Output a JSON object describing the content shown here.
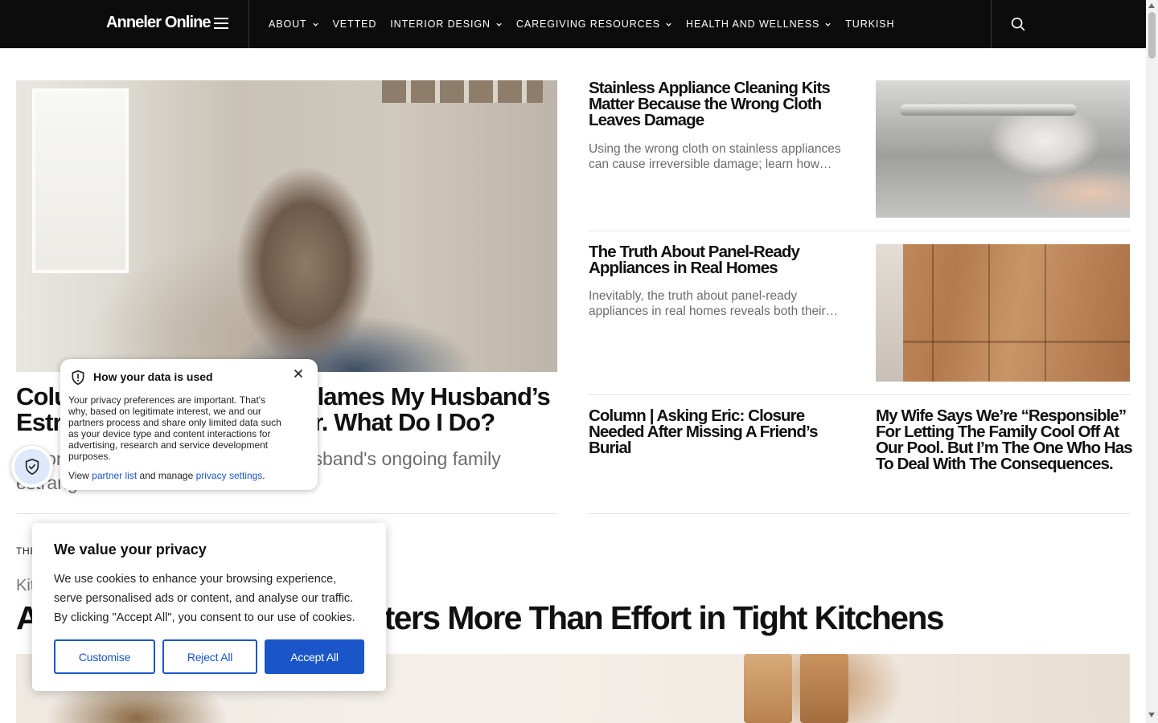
{
  "header": {
    "logo": "Anneler Online",
    "nav": [
      {
        "label": "ABOUT",
        "has_dropdown": true
      },
      {
        "label": "VETTED",
        "has_dropdown": false
      },
      {
        "label": "INTERIOR DESIGN",
        "has_dropdown": true
      },
      {
        "label": "CAREGIVING RESOURCES",
        "has_dropdown": true
      },
      {
        "label": "HEALTH AND WELLNESS",
        "has_dropdown": true
      },
      {
        "label": "TURKISH",
        "has_dropdown": false
      }
    ],
    "icons": {
      "menu": "hamburger-icon",
      "search": "search-icon"
    },
    "background": "#0c0c0c"
  },
  "lead_article": {
    "headline": "Column | My Stepmother Blames My Husband’s Estrangement on His Sister. What Do I Do?",
    "excerpt": "A woman seeks advice about her husband's ongoing family estrangement"
  },
  "articles": [
    {
      "headline": "Stainless Appliance Cleaning Kits Matter Because the Wrong Cloth Leaves Damage",
      "excerpt": "Using the wrong cloth on stainless appliances can cause irreversible damage; learn how…"
    },
    {
      "headline": "The Truth About Panel-Ready Appliances in Real Homes",
      "excerpt": "Inevitably, the truth about panel-ready appliances in real homes reveals both their…"
    },
    {
      "headline": "Column | Asking Eric: Closure Needed After Missing A Friend’s Burial"
    },
    {
      "headline": "My Wife Says We’re “Responsible” For Letting The Family Cool Off At Our Pool. But I’m The One Who Has To Deal With The Consequences."
    }
  ],
  "section": {
    "label": "THE LATEST",
    "category": "Kitchen",
    "title": "Appliance Placement Matters More Than Effort in Tight Kitchens"
  },
  "data_popup": {
    "title": "How your data is used",
    "body": "Your privacy preferences are important. That's why, based on legitimate interest, we and our partners process and share only limited data such as your device type and content interactions for advertising, research and service development purposes.",
    "links_prefix": "View",
    "partner_link": "partner list",
    "links_middle": "and manage",
    "settings_link": "privacy settings",
    "links_suffix": ".",
    "icons": {
      "shield": "shield-icon",
      "close": "close-icon"
    }
  },
  "cookie_banner": {
    "title": "We value your privacy",
    "text": "We use cookies to enhance your browsing experience, serve personalised ads or content, and analyse our traffic. By clicking \"Accept All\", you consent to our use of cookies.",
    "buttons": {
      "customise": "Customise",
      "reject": "Reject All",
      "accept": "Accept All"
    },
    "accent": "#1a56c7"
  }
}
